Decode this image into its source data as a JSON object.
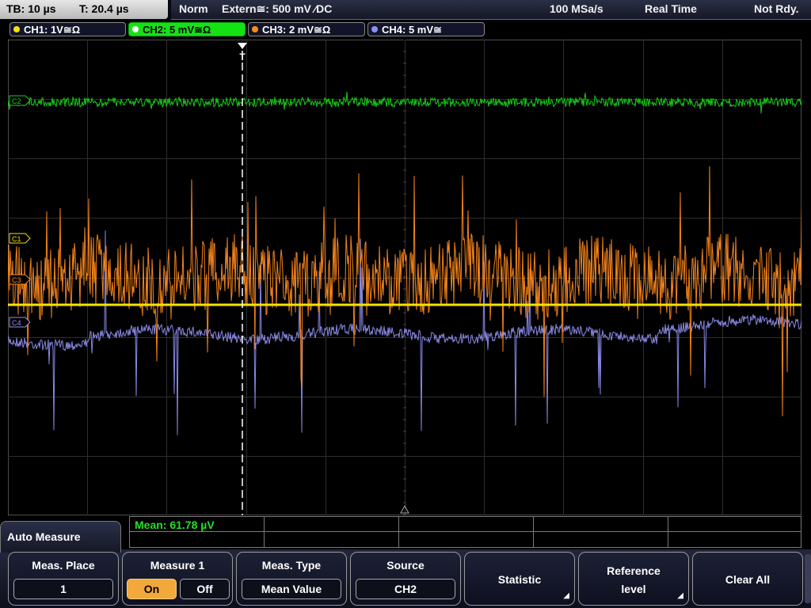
{
  "status": {
    "timebase": "TB: 10 µs",
    "trigger_time": "T: 20.4 µs",
    "mode": "Norm",
    "trigger_source": "Extern≅: 500 mV ⁄DC",
    "sample_rate": "100 MSa/s",
    "acquisition": "Real Time",
    "state": "Not Rdy."
  },
  "channels": [
    {
      "label": "CH1: 1V≅Ω",
      "color": "#f5e400",
      "active": false
    },
    {
      "label": "CH2: 5 mV≅Ω",
      "color": "#19d419",
      "active": true
    },
    {
      "label": "CH3: 2 mV≅Ω",
      "color": "#ff8a1c",
      "active": false
    },
    {
      "label": "CH4: 5 mV≅",
      "color": "#8f8ff0",
      "active": false
    }
  ],
  "markers": {
    "ch1": "C1",
    "ch2": "C2",
    "ch3": "C3",
    "ch4": "C4",
    "trigger": "T"
  },
  "measurement": {
    "mean": "Mean: 61.78 µV"
  },
  "menu": {
    "title": "Auto Measure",
    "meas_place": {
      "title": "Meas. Place",
      "value": "1"
    },
    "measure1": {
      "title": "Measure 1",
      "on": "On",
      "off": "Off",
      "selected": "On"
    },
    "meas_type": {
      "title": "Meas. Type",
      "value": "Mean Value"
    },
    "source": {
      "title": "Source",
      "value": "CH2"
    },
    "statistic": {
      "title": "Statistic"
    },
    "reference": {
      "line1": "Reference",
      "line2": "level"
    },
    "clear_all": {
      "title": "Clear All"
    }
  },
  "icons": [
    "submenu-arrow-icon",
    "trigger-marker-icon",
    "ground-symbol-icon"
  ]
}
